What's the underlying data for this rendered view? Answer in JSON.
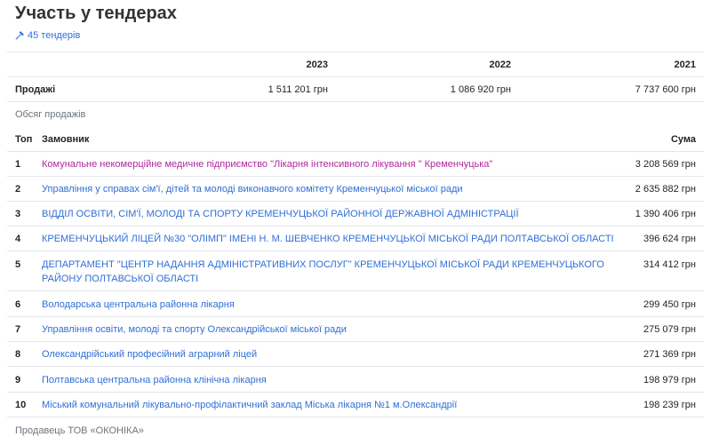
{
  "header": {
    "title": "Участь у тендерах",
    "tenders_link": "45 тендерів"
  },
  "sales": {
    "years": [
      "2023",
      "2022",
      "2021"
    ],
    "row_label": "Продажі",
    "values": [
      "1 511 201 грн",
      "1 086 920 грн",
      "7 737 600 грн"
    ],
    "caption": "Обсяг продажів"
  },
  "customers": {
    "col_top": "Топ",
    "col_customer": "Замовник",
    "col_sum": "Сума",
    "rows": [
      {
        "rank": "1",
        "name": "Комунальне некомерційне медичне підприємство \"Лікарня інтенсивного лікування \" Кременчуцька\"",
        "sum": "3 208 569 грн"
      },
      {
        "rank": "2",
        "name": "Управління у справах сім'ї, дітей та молоді виконавчого комітету Кременчуцької міської ради",
        "sum": "2 635 882 грн"
      },
      {
        "rank": "3",
        "name": "ВІДДІЛ ОСВІТИ, СІМ'Ї, МОЛОДІ ТА СПОРТУ КРЕМЕНЧУЦЬКОЇ РАЙОННОЇ ДЕРЖАВНОЇ АДМІНІСТРАЦІЇ",
        "sum": "1 390 406 грн"
      },
      {
        "rank": "4",
        "name": "КРЕМЕНЧУЦЬКИЙ ЛІЦЕЙ №30 \"ОЛІМП\" ІМЕНІ Н. М. ШЕВЧЕНКО КРЕМЕНЧУЦЬКОЇ МІСЬКОЇ РАДИ ПОЛТАВСЬКОЇ ОБЛАСТІ",
        "sum": "396 624 грн"
      },
      {
        "rank": "5",
        "name": "ДЕПАРТАМЕНТ \"ЦЕНТР НАДАННЯ АДМІНІСТРАТИВНИХ ПОСЛУГ\" КРЕМЕНЧУЦЬКОЇ МІСЬКОЇ РАДИ КРЕМЕНЧУЦЬКОГО РАЙОНУ ПОЛТАВСЬКОЇ ОБЛАСТІ",
        "sum": "314 412 грн"
      },
      {
        "rank": "6",
        "name": "Володарська центральна районна лікарня",
        "sum": "299 450 грн"
      },
      {
        "rank": "7",
        "name": "Управління освіти, молоді та спорту Олександрійської міської ради",
        "sum": "275 079 грн"
      },
      {
        "rank": "8",
        "name": "Олександрійський професійний аграрний ліцей",
        "sum": "271 369 грн"
      },
      {
        "rank": "9",
        "name": "Полтавська центральна районна клінічна лікарня",
        "sum": "198 979 грн"
      },
      {
        "rank": "10",
        "name": "Міський комунальний лікувально-профілактичний заклад Міська лікарня №1 м.Олександрії",
        "sum": "198 239 грн"
      }
    ]
  },
  "footer": {
    "seller": "Продавець ТОВ «ОКОНІКА»"
  },
  "colors": {
    "link": "#2f6fd6",
    "visited_link": "#b0279c",
    "text": "#212529",
    "muted": "#6c757d",
    "divider": "#e3e6ea"
  }
}
